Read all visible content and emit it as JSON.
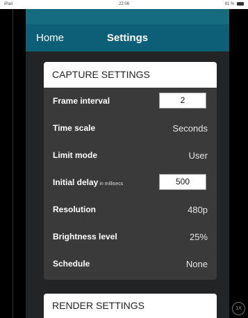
{
  "status_bar": {
    "left": "iPad",
    "time": "22:06",
    "battery": "81 %"
  },
  "nav": {
    "back_label": "Home",
    "title": "Settings"
  },
  "capture": {
    "header": "CAPTURE SETTINGS",
    "frame_interval": {
      "label": "Frame interval",
      "value": "2"
    },
    "time_scale": {
      "label": "Time scale",
      "value": "Seconds"
    },
    "limit_mode": {
      "label": "Limit mode",
      "value": "User"
    },
    "initial_delay": {
      "label": "Initial delay",
      "sublabel": "in millisecs",
      "value": "500"
    },
    "resolution": {
      "label": "Resolution",
      "value": "480p"
    },
    "brightness": {
      "label": "Brightness level",
      "value": "25%"
    },
    "schedule": {
      "label": "Schedule",
      "value": "None"
    }
  },
  "render": {
    "header": "RENDER SETTINGS"
  },
  "zoom_button": "1X",
  "colors": {
    "nav": "#0d5f78",
    "background": "#222426",
    "card": "#3a3a3a"
  }
}
